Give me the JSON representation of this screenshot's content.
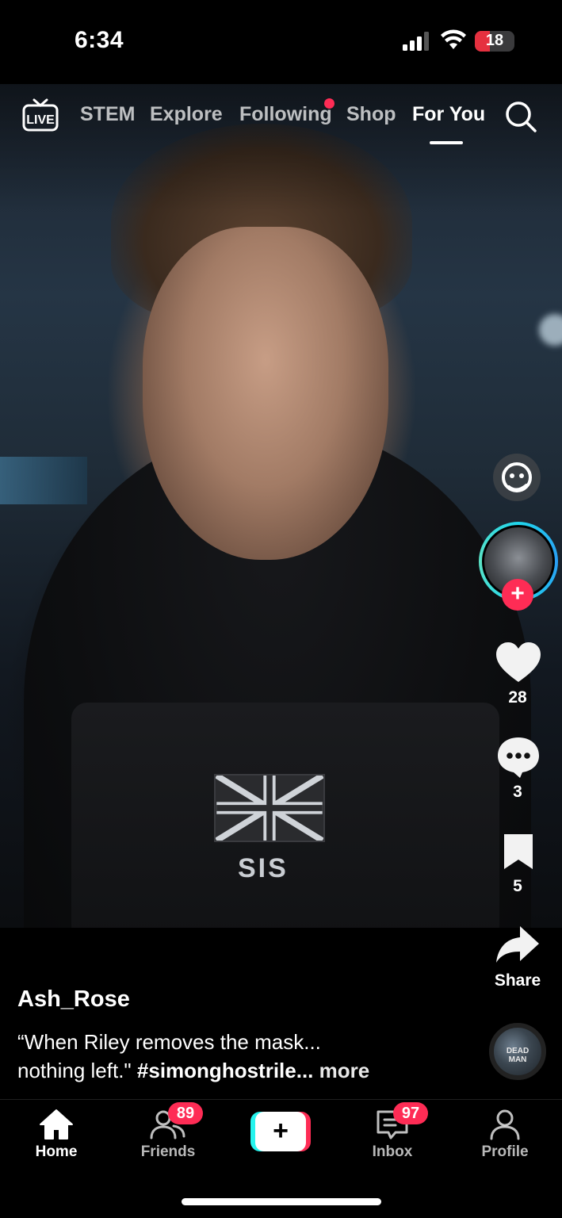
{
  "status_bar": {
    "time": "6:34",
    "battery": "18"
  },
  "top_nav": {
    "live_label": "LIVE",
    "tabs": [
      {
        "label": "STEM"
      },
      {
        "label": "Explore"
      },
      {
        "label": "Following"
      },
      {
        "label": "Shop"
      },
      {
        "label": "For You",
        "active": true
      }
    ]
  },
  "video": {
    "patch_text": "SIS"
  },
  "right_rail": {
    "likes": "28",
    "comments": "3",
    "saves": "5",
    "share_label": "Share",
    "disc_label": "DEAD MAN"
  },
  "caption": {
    "username": "Ash_Rose",
    "line1": "“When Riley removes the mask...",
    "line2_text": "nothing left.\"",
    "hashtag": "#simonghostrile...",
    "more": "more"
  },
  "tab_bar": {
    "home": "Home",
    "friends": "Friends",
    "friends_badge": "89",
    "create": "+",
    "inbox": "Inbox",
    "inbox_badge": "97",
    "profile": "Profile"
  },
  "colors": {
    "accent": "#fe2c55",
    "cyan": "#25f4ee"
  },
  "icons": [
    "live-icon",
    "search-icon",
    "effect-icon",
    "heart-icon",
    "comment-icon",
    "bookmark-icon",
    "share-icon",
    "home-icon",
    "friends-icon",
    "inbox-icon",
    "profile-icon"
  ]
}
